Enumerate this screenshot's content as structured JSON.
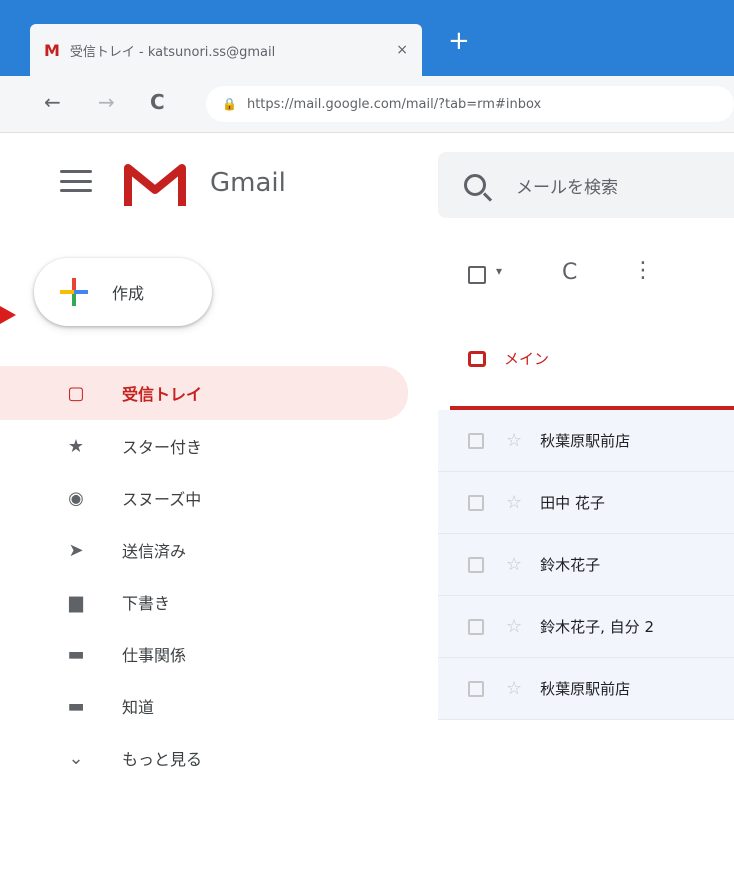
{
  "browser": {
    "tab_title": "受信トレイ - katsunori.ss@gmail",
    "favicon": "M",
    "close_glyph": "×",
    "newtab_glyph": "+",
    "url": "https://mail.google.com/mail/?tab=rm#inbox",
    "back_glyph": "←",
    "forward_glyph": "→",
    "reload_glyph": "C",
    "lock_glyph": "🔒"
  },
  "gmail": {
    "brand": "Gmail",
    "search_placeholder": "メールを検索",
    "compose_label": "作成",
    "accent_color": "#c5221f"
  },
  "sidebar": {
    "items": [
      {
        "label": "受信トレイ",
        "icon": "inbox-icon",
        "glyph": "▢",
        "active": true
      },
      {
        "label": "スター付き",
        "icon": "star-icon",
        "glyph": "★"
      },
      {
        "label": "スヌーズ中",
        "icon": "clock-icon",
        "glyph": "◉"
      },
      {
        "label": "送信済み",
        "icon": "send-icon",
        "glyph": "➤"
      },
      {
        "label": "下書き",
        "icon": "draft-icon",
        "glyph": "▆"
      },
      {
        "label": "仕事関係",
        "icon": "label-icon",
        "glyph": "▬"
      },
      {
        "label": "知道",
        "icon": "label-icon",
        "glyph": "▬"
      },
      {
        "label": "もっと見る",
        "icon": "chevron-down-icon",
        "glyph": "⌄"
      }
    ]
  },
  "toolbar": {
    "caret_glyph": "▾",
    "refresh_glyph": "C",
    "more_glyph": "⋮"
  },
  "main": {
    "tab_label": "メイン",
    "rows": [
      {
        "sender": "秋葉原駅前店"
      },
      {
        "sender": "田中 花子"
      },
      {
        "sender": "鈴木花子"
      },
      {
        "sender": "鈴木花子, 自分 2"
      },
      {
        "sender": "秋葉原駅前店"
      }
    ],
    "star_glyph": "☆"
  }
}
